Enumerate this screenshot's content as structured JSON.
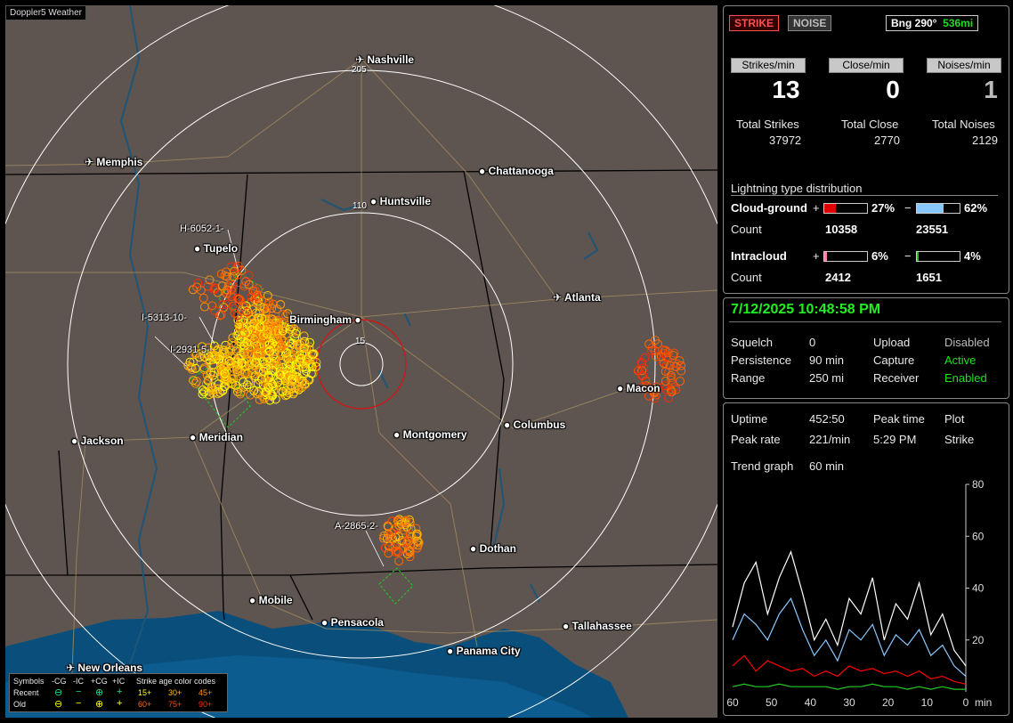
{
  "app": {
    "title": "Doppler5 Weather"
  },
  "cities": [
    {
      "name": "Nashville",
      "type": "airport"
    },
    {
      "name": "Memphis",
      "type": "airport"
    },
    {
      "name": "Chattanooga",
      "type": "city"
    },
    {
      "name": "Huntsville",
      "type": "city"
    },
    {
      "name": "Tupelo",
      "type": "city"
    },
    {
      "name": "Birmingham",
      "type": "city"
    },
    {
      "name": "Atlanta",
      "type": "airport"
    },
    {
      "name": "Macon",
      "type": "city"
    },
    {
      "name": "Columbus",
      "type": "city"
    },
    {
      "name": "Jackson",
      "type": "city"
    },
    {
      "name": "Meridian",
      "type": "city"
    },
    {
      "name": "Montgomery",
      "type": "city"
    },
    {
      "name": "Dothan",
      "type": "city"
    },
    {
      "name": "Mobile",
      "type": "city"
    },
    {
      "name": "Pensacola",
      "type": "city"
    },
    {
      "name": "Tallahassee",
      "type": "city"
    },
    {
      "name": "Panama City",
      "type": "city"
    },
    {
      "name": "New Orleans",
      "type": "airport"
    }
  ],
  "rings": [
    "205",
    "110",
    "15"
  ],
  "storms": [
    "H-6052-1-",
    "I-5313-10-",
    "I-2931-5-",
    "A-2865-2-"
  ],
  "legend": {
    "symbols_label": "Symbols",
    "cols": [
      "-CG",
      "-IC",
      "+CG",
      "+IC"
    ],
    "age_label": "Strike age color codes",
    "recent_label": "Recent",
    "old_label": "Old",
    "recent_ages": [
      "15+",
      "30+",
      "45+"
    ],
    "old_ages": [
      "60+",
      "75+",
      "90+"
    ],
    "age_colors": [
      "#ffff00",
      "#ffc000",
      "#ff9000",
      "#ff6a00",
      "#ff4a00",
      "#ff2a00"
    ]
  },
  "top": {
    "strike_btn": "STRIKE",
    "noise_btn": "NOISE",
    "bearing": "Bng 290°",
    "distance": "536mi",
    "strikes_min_label": "Strikes/min",
    "close_min_label": "Close/min",
    "noises_min_label": "Noises/min",
    "strikes_min": "13",
    "close_min": "0",
    "noises_min": "1",
    "total_strikes_label": "Total Strikes",
    "total_close_label": "Total Close",
    "total_noises_label": "Total Noises",
    "total_strikes": "37972",
    "total_close": "2770",
    "total_noises": "2129",
    "dist_title": "Lightning type distribution",
    "cg_label": "Cloud-ground",
    "ic_label": "Intracloud",
    "count_label": "Count",
    "plus": "+",
    "minus": "−",
    "cg_pos_pct": "27%",
    "cg_neg_pct": "62%",
    "cg_pos_count": "10358",
    "cg_neg_count": "23551",
    "ic_pos_pct": "6%",
    "ic_neg_pct": "4%",
    "ic_pos_count": "2412",
    "ic_neg_count": "1651",
    "cg_pos_frac": 0.27,
    "cg_neg_frac": 0.62,
    "ic_pos_frac": 0.06,
    "ic_neg_frac": 0.04,
    "colors": {
      "cg_pos": "#e00000",
      "cg_neg": "#88c8ff",
      "ic_pos": "#ff7fa8",
      "ic_neg": "#20c020"
    }
  },
  "status": {
    "datetime": "7/12/2025 10:48:58 PM",
    "squelch_label": "Squelch",
    "squelch": "0",
    "persistence_label": "Persistence",
    "persistence": "90 min",
    "range_label": "Range",
    "range": "250 mi",
    "upload_label": "Upload",
    "upload": "Disabled",
    "capture_label": "Capture",
    "capture": "Active",
    "receiver_label": "Receiver",
    "receiver": "Enabled"
  },
  "trend": {
    "uptime_label": "Uptime",
    "uptime": "452:50",
    "peak_time_label": "Peak time",
    "peak_time": "5:29 PM",
    "plot_label": "Plot",
    "plot": "Strike",
    "peak_rate_label": "Peak rate",
    "peak_rate": "221/min",
    "trend_graph_label": "Trend graph",
    "trend_graph": "60 min",
    "x_ticks": [
      "60",
      "50",
      "40",
      "30",
      "20",
      "10",
      "0"
    ],
    "x_unit": "min",
    "y_ticks": [
      "80",
      "60",
      "40",
      "20"
    ]
  },
  "chart_data": {
    "type": "line",
    "x": [
      60,
      57,
      54,
      51,
      48,
      45,
      42,
      39,
      36,
      33,
      30,
      27,
      24,
      21,
      18,
      15,
      12,
      9,
      6,
      3,
      0
    ],
    "xlim": [
      60,
      0
    ],
    "ylim": [
      0,
      80
    ],
    "series": [
      {
        "color": "#ffffff",
        "values": [
          25,
          42,
          50,
          30,
          44,
          54,
          38,
          20,
          28,
          18,
          36,
          30,
          44,
          20,
          34,
          28,
          42,
          22,
          30,
          16,
          10
        ]
      },
      {
        "color": "#88c8ff",
        "values": [
          20,
          30,
          26,
          20,
          30,
          36,
          24,
          14,
          20,
          12,
          24,
          20,
          26,
          14,
          22,
          18,
          24,
          14,
          18,
          10,
          6
        ]
      },
      {
        "color": "#ff0000",
        "values": [
          10,
          14,
          8,
          12,
          10,
          8,
          9,
          6,
          8,
          6,
          10,
          8,
          9,
          7,
          8,
          6,
          8,
          5,
          6,
          4,
          3
        ]
      },
      {
        "color": "#22cc22",
        "values": [
          2,
          3,
          2,
          2,
          3,
          2,
          2,
          2,
          2,
          1,
          2,
          2,
          3,
          2,
          2,
          1,
          2,
          1,
          2,
          1,
          1
        ]
      }
    ]
  }
}
